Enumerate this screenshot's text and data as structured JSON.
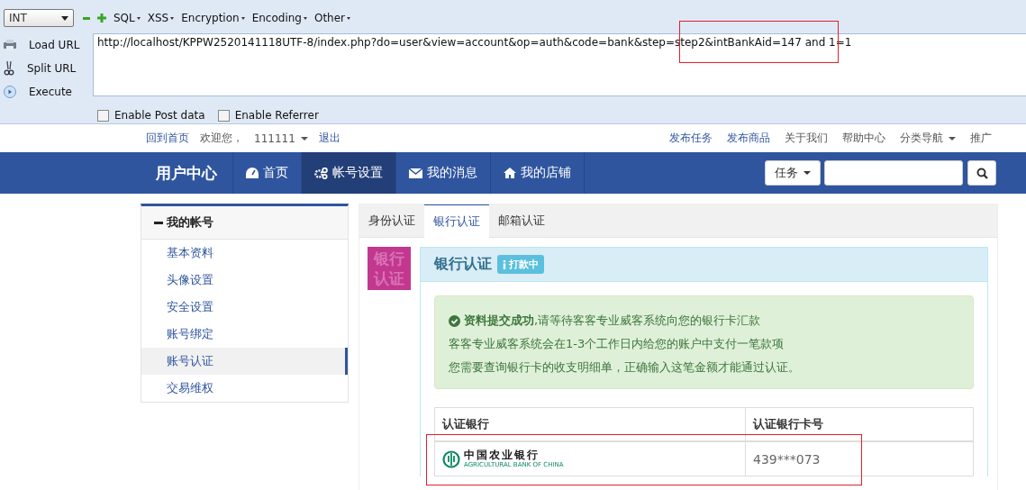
{
  "hackbar": {
    "select": "INT",
    "menus": [
      {
        "label": "SQL"
      },
      {
        "label": "XSS"
      },
      {
        "label": "Encryption"
      },
      {
        "label": "Encoding"
      },
      {
        "label": "Other"
      }
    ],
    "actions": [
      {
        "kind": "load",
        "label": "Load URL"
      },
      {
        "kind": "split",
        "label": "Split URL"
      },
      {
        "kind": "execute",
        "label": "Execute"
      }
    ],
    "url": "http://localhost/KPPW2520141118UTF-8/index.php?do=user&view=account&op=auth&code=bank&step=step2&intBankAid=147 and 1=1",
    "options": [
      {
        "label": "Enable Post data",
        "checked": false
      },
      {
        "label": "Enable Referrer",
        "checked": false
      }
    ]
  },
  "topbar": {
    "left": [
      {
        "kind": "link",
        "label": "回到首页"
      },
      {
        "kind": "text",
        "label": "欢迎您，"
      },
      {
        "kind": "user",
        "label": "111111"
      },
      {
        "kind": "link",
        "label": "退出"
      }
    ],
    "right": [
      {
        "label": "发布任务",
        "dropdown": false
      },
      {
        "label": "发布商品",
        "dropdown": false
      },
      {
        "label": "关于我们",
        "dropdown": false
      },
      {
        "label": "帮助中心",
        "dropdown": false
      },
      {
        "label": "分类导航",
        "dropdown": true
      },
      {
        "label": "推广",
        "dropdown": false
      }
    ]
  },
  "navbar": {
    "brand": "用户中心",
    "items": [
      {
        "kind": "dashboard",
        "label": "首页",
        "selected": false
      },
      {
        "kind": "settings",
        "label": "帐号设置",
        "selected": true
      },
      {
        "kind": "messages",
        "label": "我的消息",
        "selected": false
      },
      {
        "kind": "shop",
        "label": "我的店铺",
        "selected": false
      }
    ],
    "search_type": "任务"
  },
  "sidebar": {
    "title": "我的帐号",
    "items": [
      {
        "label": "基本资料",
        "selected": false
      },
      {
        "label": "头像设置",
        "selected": false
      },
      {
        "label": "安全设置",
        "selected": false
      },
      {
        "label": "账号绑定",
        "selected": false
      },
      {
        "label": "账号认证",
        "selected": true
      },
      {
        "label": "交易维权",
        "selected": false
      }
    ]
  },
  "tabs": [
    {
      "label": "身份认证",
      "selected": false
    },
    {
      "label": "银行认证",
      "selected": true
    },
    {
      "label": "邮箱认证",
      "selected": false
    }
  ],
  "badge_image": "银行认证",
  "panel": {
    "title": "银行认证",
    "status": "打款中",
    "alert": {
      "lead": "**资料提交成功**,请等待客客专业威客系统向您的银行卡汇款",
      "lines": [
        "客客专业威客系统会在1-3个工作日内给您的账户中支付一笔款项",
        "您需要查询银行卡的收支明细单，正确输入这笔金额才能通过认证。"
      ]
    },
    "table": {
      "columns": [
        "认证银行",
        "认证银行卡号"
      ],
      "rows": [
        {
          "bank_name": "中国农业银行",
          "bank_name_en": "AGRICULTURAL BANK OF CHINA",
          "card": "439***073"
        }
      ]
    }
  }
}
